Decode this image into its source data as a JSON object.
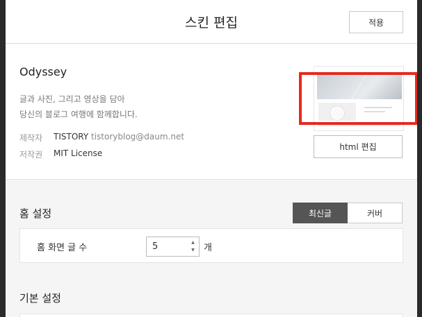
{
  "header": {
    "title": "스킨 편집",
    "apply_label": "적용"
  },
  "skin": {
    "name": "Odyssey",
    "description_line1": "글과 사진, 그리고 영상을 담아",
    "description_line2": "당신의 블로그 여행에 함께합니다.",
    "author_label": "제작자",
    "author_name": "TISTORY",
    "author_email": "tistoryblog@daum.net",
    "license_label": "저작권",
    "license_value": "MIT License",
    "html_edit_label": "html 편집"
  },
  "home_settings": {
    "title": "홈 설정",
    "options": [
      "최신글",
      "커버"
    ],
    "selected": "최신글",
    "post_count_label": "홈 화면 글 수",
    "post_count_value": "5",
    "post_count_unit": "개"
  },
  "basic_settings": {
    "title": "기본 설정"
  },
  "colors": {
    "highlight": "#e8281d",
    "active_toggle": "#555555"
  }
}
